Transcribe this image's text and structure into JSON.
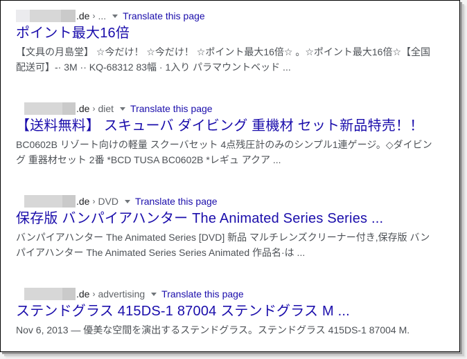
{
  "results": [
    {
      "domain_suffix": ".de",
      "separator": "›",
      "path": "...",
      "translate_label": "Translate this page",
      "title": "ポイント最大16倍",
      "snippet": "【文具の月島堂】 ☆今だけ！ ☆今だけ！ ☆ポイント最大16倍☆ 。☆ポイント最大16倍☆【全国配送可】-· 3M ·· KQ-68312 83幅 · 1入り パラマウントベッド ..."
    },
    {
      "domain_suffix": ".de",
      "separator": "›",
      "path": "diet",
      "translate_label": "Translate this page",
      "title": "【送料無料】 スキューバ ダイビング 重機材 セット新品特売！！",
      "snippet": "BC0602B リゾート向けの軽量 スクーバセット 4点残圧計のみのシンプル1連ゲージ。◇ダイビング 重器材セット 2番 *BCD TUSA BC0602B *レギュ アクア ..."
    },
    {
      "domain_suffix": ".de",
      "separator": "›",
      "path": "DVD",
      "translate_label": "Translate this page",
      "title": "保存版 バンパイアハンター The Animated Series Series ...",
      "snippet": "バンパイアハンター The Animated Series [DVD] 新品 マルチレンズクリーナー付き,保存版 バンパイアハンター The Animated Series Series Animated 作品名·は ..."
    },
    {
      "domain_suffix": ".de",
      "separator": "›",
      "path": "advertising",
      "translate_label": "Translate this page",
      "title": "ステンドグラス 415DS-1 87004 ステンドグラス M ...",
      "snippet": "Nov 6, 2013 — 優美な空間を演出するステンドグラス。ステンドグラス 415DS-1 87004 M."
    }
  ],
  "colors": {
    "title_link": "#1a0dab",
    "snippet_text": "#4d5156",
    "cite_text": "#202124",
    "redaction": "#d7d7d7"
  }
}
